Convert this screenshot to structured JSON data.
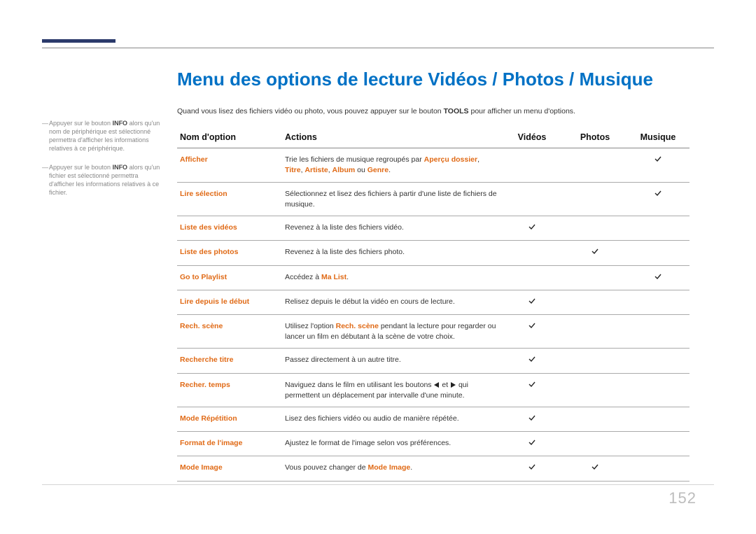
{
  "page_number": "152",
  "title": "Menu des options de lecture Vidéos / Photos / Musique",
  "intro_pre": "Quand vous lisez des fichiers vidéo ou photo, vous pouvez appuyer sur le bouton ",
  "intro_bold": "TOOLS",
  "intro_post": " pour afficher un menu d'options.",
  "sidebar": {
    "notes": [
      {
        "pre": "Appuyer sur le bouton ",
        "bold": "INFO",
        "post": " alors qu'un nom de périphérique est sélectionné permettra d'afficher les informations relatives à ce périphérique."
      },
      {
        "pre": "Appuyer sur le bouton ",
        "bold": "INFO",
        "post": " alors qu'un fichier est sélectionné permettra d'afficher les informations relatives à ce fichier."
      }
    ]
  },
  "columns": {
    "name": "Nom d'option",
    "actions": "Actions",
    "videos": "Vidéos",
    "photos": "Photos",
    "music": "Musique"
  },
  "rows": [
    {
      "name": "Afficher",
      "action_pre": "Trie les fichiers de musique regroupés par ",
      "action_hl1": "Aperçu dossier",
      "action_mid": ", ",
      "action_hl2": "Titre",
      "action_mid2": ", ",
      "action_hl3": "Artiste",
      "action_mid3": ", ",
      "action_hl4": "Album",
      "action_mid4": " ou ",
      "action_hl5": "Genre",
      "action_post": ".",
      "v": "",
      "p": "",
      "m": "c"
    },
    {
      "name": "Lire sélection",
      "action_pre": "Sélectionnez et lisez des fichiers à partir d'une liste de fichiers de musique.",
      "v": "",
      "p": "",
      "m": "c"
    },
    {
      "name": "Liste des vidéos",
      "action_pre": "Revenez à la liste des fichiers vidéo.",
      "v": "c",
      "p": "",
      "m": ""
    },
    {
      "name": "Liste des photos",
      "action_pre": "Revenez à la liste des fichiers photo.",
      "v": "",
      "p": "c",
      "m": ""
    },
    {
      "name": "Go to Playlist",
      "action_pre": "Accédez à ",
      "action_hl1": "Ma List",
      "action_post": ".",
      "v": "",
      "p": "",
      "m": "c"
    },
    {
      "name": "Lire depuis le début",
      "action_pre": "Relisez depuis le début la vidéo en cours de lecture.",
      "v": "c",
      "p": "",
      "m": ""
    },
    {
      "name": "Rech. scène",
      "action_pre": "Utilisez l'option ",
      "action_hl1": "Rech. scène",
      "action_post": " pendant la lecture pour regarder ou lancer un film en débutant à la scène de votre choix.",
      "v": "c",
      "p": "",
      "m": ""
    },
    {
      "name": "Recherche titre",
      "action_pre": "Passez directement à un autre titre.",
      "v": "c",
      "p": "",
      "m": ""
    },
    {
      "name": "Recher. temps",
      "nav": true,
      "action_pre": "Naviguez dans le film en utilisant les boutons ",
      "action_mid": " et ",
      "action_post": " qui permettent un déplacement par intervalle d'une minute.",
      "v": "c",
      "p": "",
      "m": ""
    },
    {
      "name": "Mode Répétition",
      "action_pre": "Lisez des fichiers vidéo ou audio de manière répétée.",
      "v": "c",
      "p": "",
      "m": ""
    },
    {
      "name": "Format de l'image",
      "action_pre": "Ajustez le format de l'image selon vos préférences.",
      "v": "c",
      "p": "",
      "m": ""
    },
    {
      "name": "Mode Image",
      "action_pre": "Vous pouvez changer de ",
      "action_hl1": "Mode Image",
      "action_post": ".",
      "v": "c",
      "p": "c",
      "m": ""
    }
  ],
  "check_glyph": "c"
}
